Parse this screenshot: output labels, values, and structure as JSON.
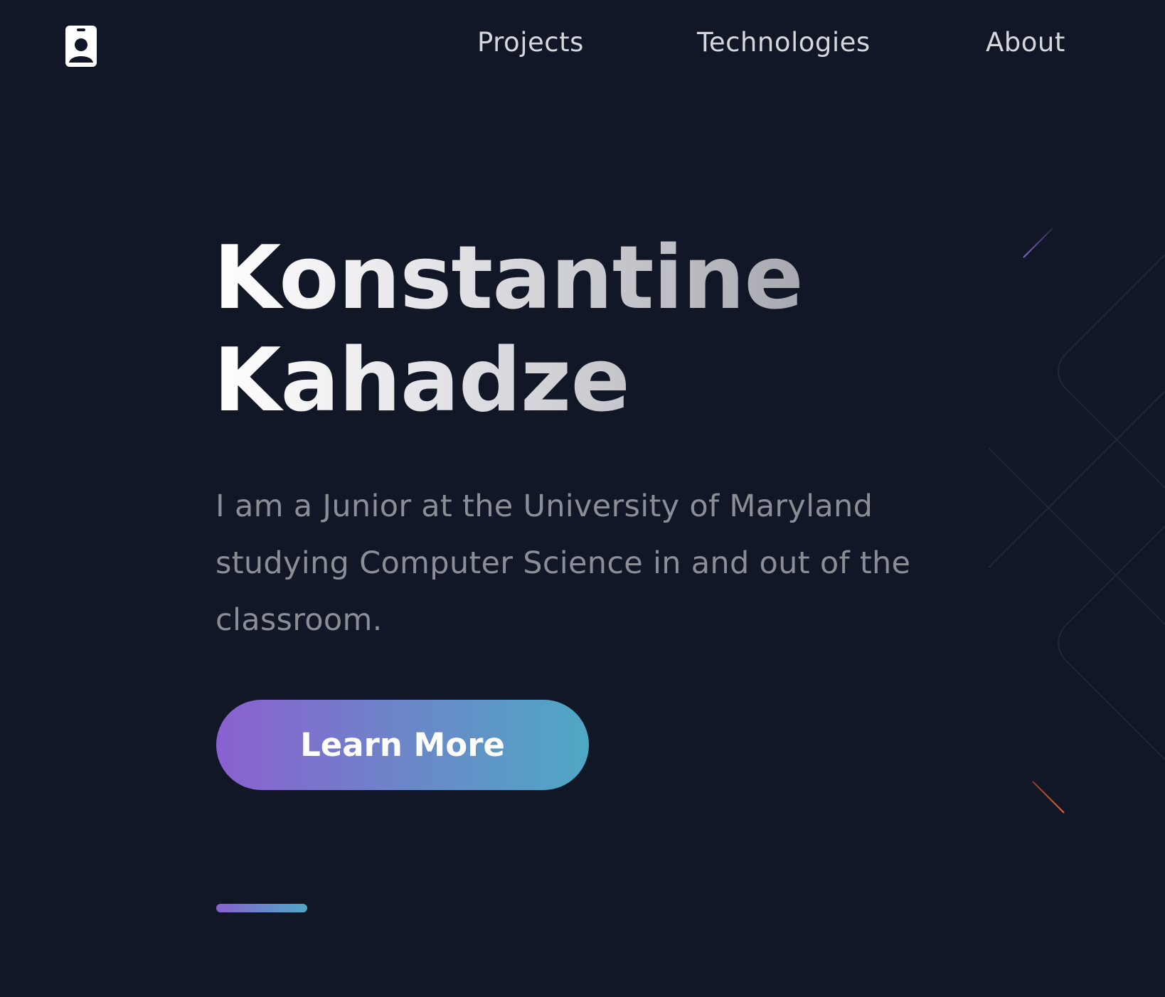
{
  "header": {
    "logo_icon": "id-badge-icon",
    "nav": [
      {
        "label": "Projects"
      },
      {
        "label": "Technologies"
      },
      {
        "label": "About"
      }
    ]
  },
  "hero": {
    "title_line1": "Konstantine",
    "title_line2": "Kahadze",
    "description": "I am a Junior at the University of Maryland studying Computer Science in and out of the classroom.",
    "cta_label": "Learn More"
  },
  "colors": {
    "background": "#111726",
    "gradient_start": "#8a60d0",
    "gradient_end": "#4ea8c4",
    "accent_orange": "#e0683c"
  }
}
